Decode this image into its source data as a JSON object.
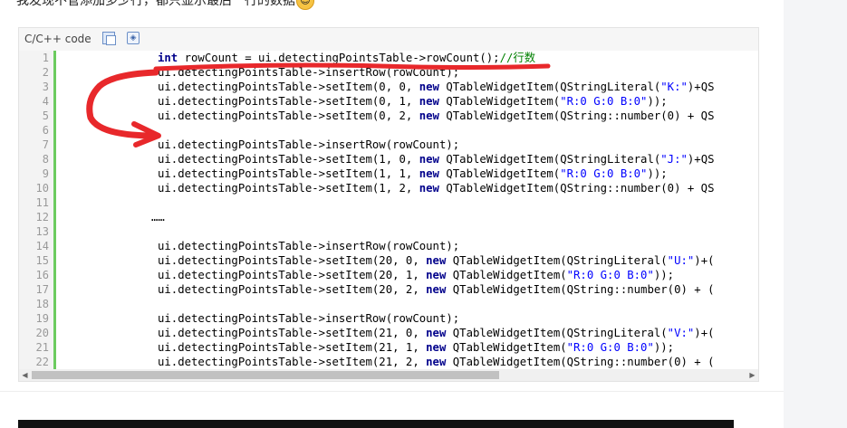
{
  "intro_text": "我发现不管添加多少行，都只显示最后一行的数据",
  "code_block": {
    "language_label": "C/C++ code",
    "copy_icon": "copy-icon",
    "view_source_icon": "view-source-icon",
    "line_numbers": [
      "1",
      "2",
      "3",
      "4",
      "5",
      "6",
      "7",
      "8",
      "9",
      "10",
      "11",
      "12",
      "13",
      "14",
      "15",
      "16",
      "17",
      "18",
      "19",
      "20",
      "21",
      "22"
    ]
  },
  "code": {
    "l1": {
      "kw": "int",
      "rest": " rowCount = ui.detectingPointsTable->rowCount();",
      "comment": "//行数"
    },
    "l2": {
      "text": "ui.detectingPointsTable->insertRow(rowCount);"
    },
    "l3": {
      "a": "ui.detectingPointsTable->setItem(0, 0, ",
      "kw": "new",
      "b": " QTableWidgetItem(QStringLiteral(",
      "str": "\"K:\"",
      "c": ")+QS"
    },
    "l4": {
      "a": "ui.detectingPointsTable->setItem(0, 1, ",
      "kw": "new",
      "b": " QTableWidgetItem(",
      "str": "\"R:0 G:0 B:0\"",
      "c": "));"
    },
    "l5": {
      "a": "ui.detectingPointsTable->setItem(0, 2, ",
      "kw": "new",
      "b": " QTableWidgetItem(QString::number(0) + QS"
    },
    "l7": {
      "text": "ui.detectingPointsTable->insertRow(rowCount);"
    },
    "l8": {
      "a": "ui.detectingPointsTable->setItem(1, 0, ",
      "kw": "new",
      "b": " QTableWidgetItem(QStringLiteral(",
      "str": "\"J:\"",
      "c": ")+QS"
    },
    "l9": {
      "a": "ui.detectingPointsTable->setItem(1, 1, ",
      "kw": "new",
      "b": " QTableWidgetItem(",
      "str": "\"R:0 G:0 B:0\"",
      "c": "));"
    },
    "l10": {
      "a": "ui.detectingPointsTable->setItem(1, 2, ",
      "kw": "new",
      "b": " QTableWidgetItem(QString::number(0) + QS"
    },
    "l12": {
      "text": "……"
    },
    "l14": {
      "text": "ui.detectingPointsTable->insertRow(rowCount);"
    },
    "l15": {
      "a": "ui.detectingPointsTable->setItem(20, 0, ",
      "kw": "new",
      "b": " QTableWidgetItem(QStringLiteral(",
      "str": "\"U:\"",
      "c": ")+("
    },
    "l16": {
      "a": "ui.detectingPointsTable->setItem(20, 1, ",
      "kw": "new",
      "b": " QTableWidgetItem(",
      "str": "\"R:0 G:0 B:0\"",
      "c": "));"
    },
    "l17": {
      "a": "ui.detectingPointsTable->setItem(20, 2, ",
      "kw": "new",
      "b": " QTableWidgetItem(QString::number(0) + ("
    },
    "l19": {
      "text": "ui.detectingPointsTable->insertRow(rowCount);"
    },
    "l20": {
      "a": "ui.detectingPointsTable->setItem(21, 0, ",
      "kw": "new",
      "b": " QTableWidgetItem(QStringLiteral(",
      "str": "\"V:\"",
      "c": ")+("
    },
    "l21": {
      "a": "ui.detectingPointsTable->setItem(21, 1, ",
      "kw": "new",
      "b": " QTableWidgetItem(",
      "str": "\"R:0 G:0 B:0\"",
      "c": "));"
    },
    "l22": {
      "a": "ui.detectingPointsTable->setItem(21, 2, ",
      "kw": "new",
      "b": " QTableWidgetItem(QString::number(0) + ("
    }
  },
  "scrollbar": {
    "left_arrow": "◀",
    "right_arrow": "▶"
  },
  "colors": {
    "annotation_red": "#e8282b",
    "keyword": "#00008b",
    "string": "#0000ff",
    "comment": "#008000",
    "gutter_bar": "#6ccb5f"
  }
}
